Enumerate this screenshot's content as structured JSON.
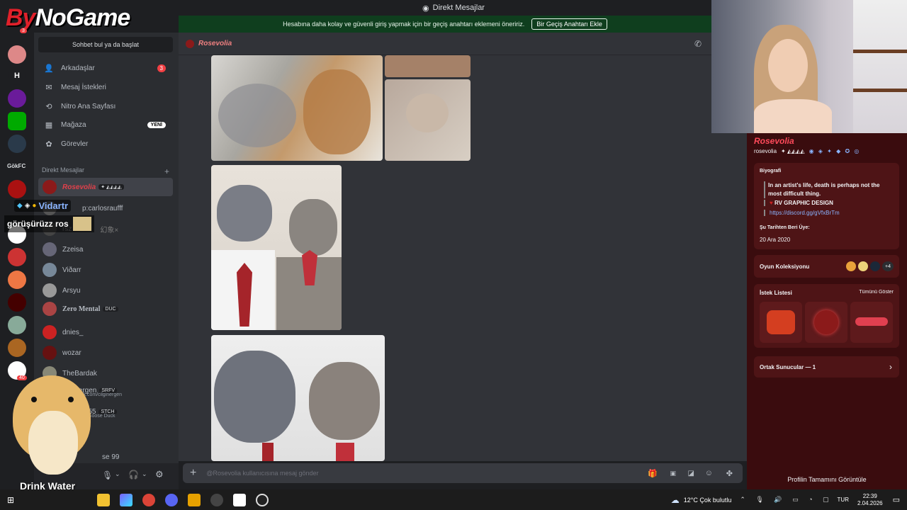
{
  "window": {
    "title": "Direkt Mesajlar"
  },
  "logo": {
    "text_a": "By",
    "text_b": "NoGame"
  },
  "banner": {
    "message": "Hesabına daha kolay ve güvenli giriş yapmak için bir geçiş anahtarı eklemeni öneririz.",
    "button": "Bir Geçiş Anahtarı Ekle"
  },
  "servers": {
    "h_label": "H",
    "gokfc": "GökFC",
    "badge_3": "3",
    "badge_40": "40"
  },
  "sidebar": {
    "search_placeholder": "Sohbet bul ya da başlat",
    "nav": [
      {
        "label": "Arkadaşlar",
        "badge": "3",
        "icon": "friends-icon"
      },
      {
        "label": "Mesaj İstekleri",
        "icon": "mail-icon"
      },
      {
        "label": "Nitro Ana Sayfası",
        "icon": "nitro-icon"
      },
      {
        "label": "Mağaza",
        "badge_new": "YENİ",
        "icon": "shop-icon"
      },
      {
        "label": "Görevler",
        "icon": "quest-icon"
      }
    ],
    "dm_header": "Direkt Mesajlar",
    "dm_add": "+",
    "dms": [
      {
        "name": "Rosevolia",
        "tag": "✦ ◭◭◭◭"
      },
      {
        "name": "p:carlosraufff"
      },
      {
        "name": "幻象×",
        "prefix": "rsz"
      },
      {
        "name": "Zzeisa"
      },
      {
        "name": "Viðarr"
      },
      {
        "name": "Arsyu"
      },
      {
        "name": "Zero Mental",
        "tag": "DUC"
      },
      {
        "name": "dnies_"
      },
      {
        "name": "wozar"
      },
      {
        "name": "TheBardak"
      },
      {
        "name": "cilginergen",
        "tag": "SRFV",
        "sub": "https://kick.com/cilginergen"
      },
      {
        "name": "ley055",
        "tag": "STCH",
        "sub": "Goose Duck"
      },
      {
        "name": "se 99"
      }
    ]
  },
  "overlay_chat": {
    "user": "Vidartr",
    "message": "görüşürüzz ros"
  },
  "hamster": {
    "caption": "Drink Water"
  },
  "chat": {
    "recipient": "Rosevolia",
    "composer_placeholder": "@Rosevolia kullanıcısına mesaj gönder"
  },
  "profile": {
    "display_name": "Rosevolia",
    "username": "rosevolia",
    "username_tag": "✦ ◭◭◭◭",
    "bio_title": "Biyografi",
    "bio_line1": "In an artist's life, death is perhaps not the most difficult thing.",
    "bio_line2": "RV GRAPHIC DESIGN",
    "bio_link": "https://discord.gg/gVfxBrTm",
    "member_since_title": "Şu Tarihten Beri Üye:",
    "member_since": "20 Ara 2020",
    "games_title": "Oyun Koleksiyonu",
    "games_more": "+4",
    "wishlist_title": "İstek Listesi",
    "wishlist_show_all": "Tümünü Göster",
    "mutual_servers": "Ortak Sunucular — 1",
    "view_full": "Profilin Tamamını Görüntüle"
  },
  "taskbar": {
    "weather": "12°C  Çok bulutlu",
    "lang": "TUR",
    "time": "22:39",
    "date": "2.04.2026"
  },
  "colors": {
    "accent_green": "#0f3e1e",
    "profile_bg": "#3a0c0e",
    "discord_dark": "#313338"
  }
}
